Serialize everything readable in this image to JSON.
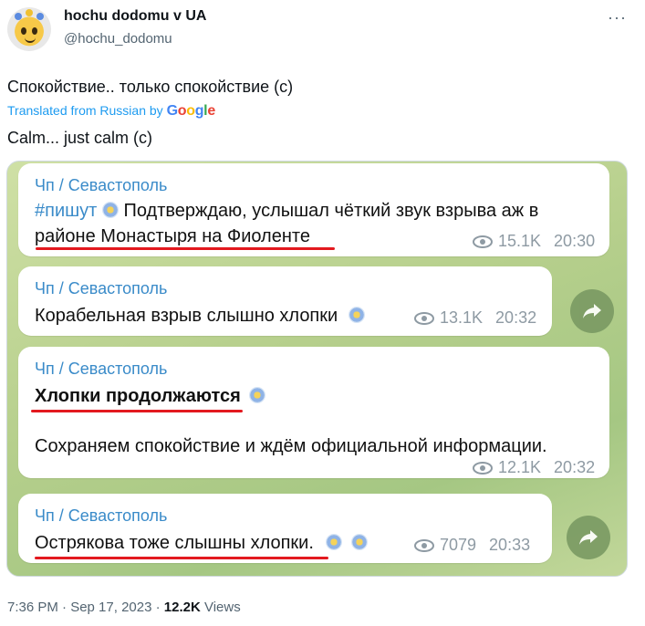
{
  "author": {
    "name": "hochu dodomu v UA",
    "handle": "@hochu_dodomu"
  },
  "tweet": {
    "text": "Спокойствие.. только спокойствие (с)",
    "translated_label": "Translated from Russian by",
    "translation": "Calm... just calm (c)",
    "time": "7:36 PM · Sep 17, 2023 ·",
    "views_count": "12.2K",
    "views_label": "Views"
  },
  "google_logo": [
    "G",
    "o",
    "o",
    "g",
    "l",
    "e"
  ],
  "messages": [
    {
      "channel": "Чп / Севастополь",
      "hashtag": "#пишут",
      "line1": "Подтверждаю, услышал чёткий звук взрыва аж в",
      "line2": "районе Монастыря на Фиоленте",
      "views": "15.1K",
      "time": "20:30"
    },
    {
      "channel": "Чп / Севастополь",
      "line1": "Корабельная взрыв слышно хлопки",
      "views": "13.1K",
      "time": "20:32"
    },
    {
      "channel": "Чп / Севастополь",
      "line1": "Хлопки продолжаются",
      "line2": "Сохраняем спокойствие и ждём официальной информации.",
      "views": "12.1K",
      "time": "20:32"
    },
    {
      "channel": "Чп / Севастополь",
      "line1": "Острякова тоже слышны хлопки.",
      "views": "7079",
      "time": "20:33"
    }
  ],
  "colors": {
    "channel": "#3a8bc9",
    "underline": "#e3191f",
    "link": "#1d9bf0",
    "background": "#b6cf8c"
  }
}
